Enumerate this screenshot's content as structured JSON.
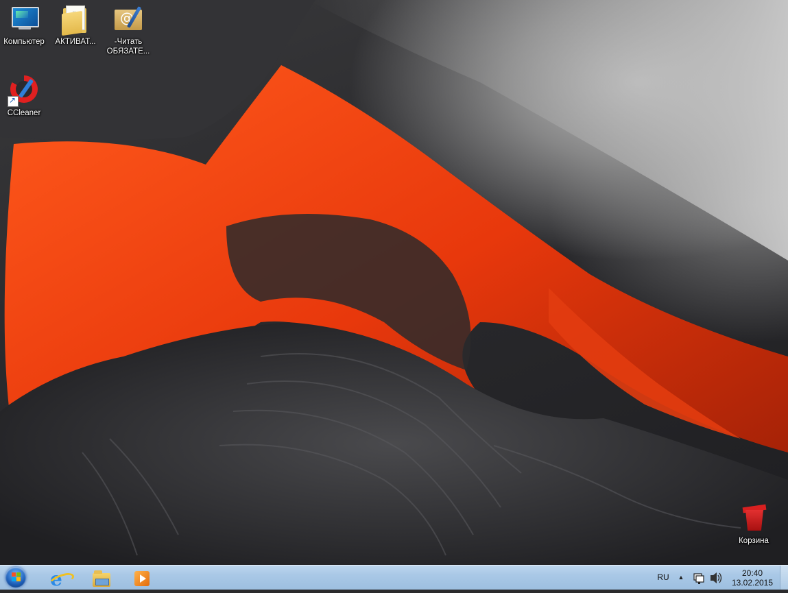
{
  "desktop": {
    "icons": [
      {
        "label": "Компьютер",
        "icon": "computer-icon"
      },
      {
        "label": "АКТИВАТ...",
        "icon": "folder-icon"
      },
      {
        "label": "-Читать\nОБЯЗАТЕ...",
        "icon": "mail-document-icon"
      },
      {
        "label": "CCleaner",
        "icon": "ccleaner-icon"
      },
      {
        "label": "Корзина",
        "icon": "recycle-bin-icon"
      }
    ],
    "wallpaper": "lava-flow",
    "accent_colors": {
      "lava": "#ff4a12",
      "rock": "#2b2b2e",
      "fog": "#c8c8c8"
    }
  },
  "taskbar": {
    "start": {
      "icon": "windows-start-orb"
    },
    "pinned": [
      {
        "name": "Internet Explorer",
        "icon": "internet-explorer-icon"
      },
      {
        "name": "Explorer",
        "icon": "file-explorer-icon"
      },
      {
        "name": "Media Player",
        "icon": "media-player-icon"
      }
    ],
    "tray": {
      "language": "RU",
      "overflow_arrow": "▲",
      "time": "20:40",
      "date": "13.02.2015"
    },
    "color": "#a9c8e6"
  }
}
